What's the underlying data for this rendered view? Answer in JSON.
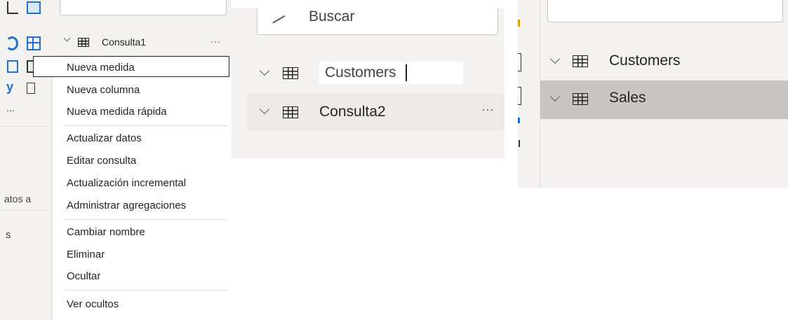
{
  "panel1": {
    "left_strip_text_1": "atos a",
    "left_strip_text_2": "s",
    "left_strip_ellipsis": "...",
    "tree_item": "Consulta1",
    "tree_more": "···",
    "context_menu": {
      "group1": [
        "Nueva medida",
        "Nueva columna",
        "Nueva medida rápida"
      ],
      "group2": [
        "Actualizar datos",
        "Editar consulta",
        "Actualización incremental",
        "Administrar agregaciones"
      ],
      "group3": [
        "Cambiar nombre",
        "Eliminar",
        "Ocultar"
      ],
      "group4": [
        "Ver ocultos"
      ]
    }
  },
  "panel2": {
    "search_label": "Buscar",
    "rename_value": "Customers",
    "tree_item": "Consulta2",
    "tree_more": "···"
  },
  "panel3": {
    "items": [
      "Customers",
      "Sales"
    ]
  },
  "colors": {
    "pane_bg": "#f3f2f1",
    "selected_row_bg": "#c8c6c4",
    "accent_blue": "#1f6fd1",
    "accent_yellow": "#d9a400"
  }
}
